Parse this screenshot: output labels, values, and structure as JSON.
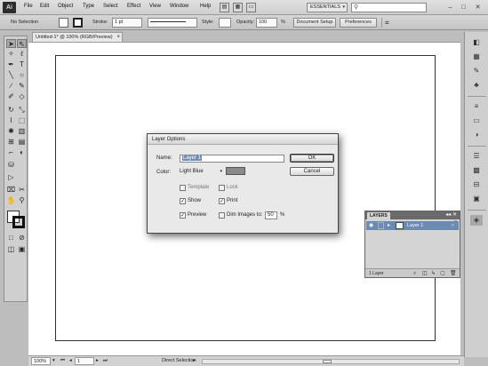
{
  "menubar": {
    "logo": "Ai",
    "items": [
      "File",
      "Edit",
      "Object",
      "Type",
      "Select",
      "Effect",
      "View",
      "Window",
      "Help"
    ],
    "workspace": "ESSENTIALS"
  },
  "controlbar": {
    "selection": "No Selection",
    "stroke_label": "Stroke:",
    "stroke_value": "1 pt",
    "style_label": "Style:",
    "opacity_label": "Opacity:",
    "opacity_value": "100",
    "opacity_unit": "%",
    "doc_setup": "Document Setup",
    "preferences": "Preferences"
  },
  "document": {
    "tab_title": "Untitled-1* @ 100% (RGB/Preview)",
    "close_glyph": "×"
  },
  "statusbar": {
    "zoom": "100%",
    "artboard": "1",
    "tool": "Direct Selection"
  },
  "dialog": {
    "title": "Layer Options",
    "name_label": "Name:",
    "name_value": "Layer 1",
    "color_label": "Color:",
    "color_value": "Light Blue",
    "ok": "OK",
    "cancel": "Cancel",
    "template": "Template",
    "lock": "Lock",
    "show": "Show",
    "print": "Print",
    "preview": "Preview",
    "dim": "Dim Images to:",
    "dim_value": "50",
    "dim_unit": "%",
    "checks": {
      "template": false,
      "lock": false,
      "show": true,
      "print": true,
      "preview": true,
      "dim": false
    }
  },
  "layers": {
    "tab": "LAYERS",
    "layer_name": "Layer 1",
    "footer": "1 Layer"
  },
  "colors": {
    "selection": "#6c8bb2",
    "swatch": "#8a8a8a"
  }
}
